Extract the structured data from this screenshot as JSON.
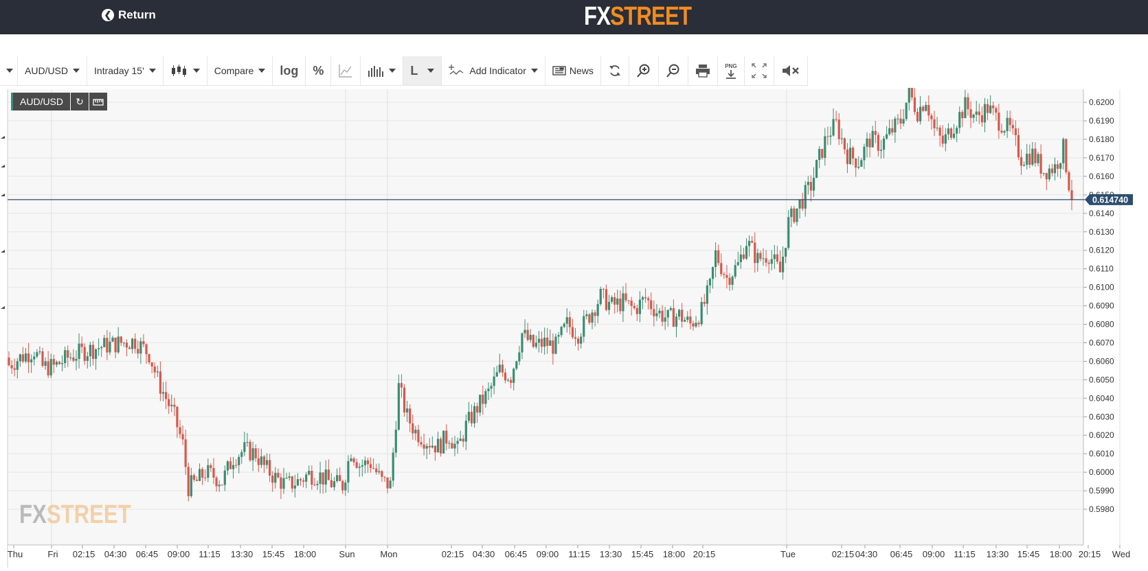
{
  "header": {
    "return_label": "Return",
    "logo_fx": "FX",
    "logo_street": "STREET"
  },
  "toolbar": {
    "symbol": "AUD/USD",
    "interval": "Intraday 15'",
    "compare": "Compare",
    "log": "log",
    "percent": "%",
    "line_label": "L",
    "add_indicator": "Add Indicator",
    "news": "News",
    "png_label": "PNG"
  },
  "badge": {
    "symbol": "AUD/USD"
  },
  "watermark": {
    "fx": "FX",
    "street": "STREET"
  },
  "colors": {
    "up": "#3a8c72",
    "down": "#d9574a",
    "price_line": "#2a4a6a",
    "price_bg": "#2c4e6e"
  },
  "chart_data": {
    "type": "candlestick",
    "symbol": "AUD/USD",
    "interval": "15 min",
    "current_price": "0.614740",
    "ylim": [
      0.598,
      0.6205
    ],
    "y_ticks": [
      "0.6200",
      "0.6190",
      "0.6180",
      "0.6170",
      "0.6160",
      "0.6150",
      "0.6140",
      "0.6130",
      "0.6120",
      "0.6110",
      "0.6100",
      "0.6090",
      "0.6080",
      "0.6070",
      "0.6060",
      "0.6050",
      "0.6040",
      "0.6030",
      "0.6020",
      "0.6010",
      "0.6000",
      "0.5990",
      "0.5980"
    ],
    "x_labels": [
      "Thu",
      "Fri",
      "02:15",
      "04:30",
      "06:45",
      "09:00",
      "11:15",
      "13:30",
      "15:45",
      "18:00",
      "Sun",
      "Mon",
      "02:15",
      "04:30",
      "06:45",
      "09:00",
      "11:15",
      "13:30",
      "15:45",
      "18:00",
      "20:15",
      "Tue",
      "02:15",
      "04:30",
      "06:45",
      "09:00",
      "11:15",
      "13:30",
      "15:45",
      "18:00",
      "20:15",
      "Wed"
    ],
    "close_path": [
      {
        "i": 0,
        "v": 0.6058
      },
      {
        "i": 4,
        "v": 0.6062
      },
      {
        "i": 9,
        "v": 0.6066
      },
      {
        "i": 12,
        "v": 0.6057
      },
      {
        "i": 16,
        "v": 0.6057
      },
      {
        "i": 21,
        "v": 0.6062
      },
      {
        "i": 26,
        "v": 0.6065
      },
      {
        "i": 33,
        "v": 0.6068
      },
      {
        "i": 40,
        "v": 0.607
      },
      {
        "i": 45,
        "v": 0.6071
      },
      {
        "i": 50,
        "v": 0.6064
      },
      {
        "i": 53,
        "v": 0.605
      },
      {
        "i": 56,
        "v": 0.604
      },
      {
        "i": 59,
        "v": 0.603
      },
      {
        "i": 62,
        "v": 0.6015
      },
      {
        "i": 64,
        "v": 0.5992
      },
      {
        "i": 67,
        "v": 0.5995
      },
      {
        "i": 70,
        "v": 0.6
      },
      {
        "i": 73,
        "v": 0.5998
      },
      {
        "i": 76,
        "v": 0.5995
      },
      {
        "i": 80,
        "v": 0.6008
      },
      {
        "i": 84,
        "v": 0.6012
      },
      {
        "i": 88,
        "v": 0.601
      },
      {
        "i": 91,
        "v": 0.6003
      },
      {
        "i": 95,
        "v": 0.5997
      },
      {
        "i": 99,
        "v": 0.5993
      },
      {
        "i": 103,
        "v": 0.5995
      },
      {
        "i": 107,
        "v": 0.5999
      },
      {
        "i": 111,
        "v": 0.5998
      },
      {
        "i": 115,
        "v": 0.5994
      },
      {
        "i": 119,
        "v": 0.5993
      },
      {
        "i": 122,
        "v": 0.6012
      },
      {
        "i": 125,
        "v": 0.6004
      },
      {
        "i": 129,
        "v": 0.6005
      },
      {
        "i": 133,
        "v": 0.5995
      },
      {
        "i": 136,
        "v": 0.5993
      },
      {
        "i": 139,
        "v": 0.6046
      },
      {
        "i": 142,
        "v": 0.603
      },
      {
        "i": 145,
        "v": 0.6022
      },
      {
        "i": 149,
        "v": 0.6017
      },
      {
        "i": 153,
        "v": 0.6014
      },
      {
        "i": 157,
        "v": 0.602
      },
      {
        "i": 160,
        "v": 0.6012
      },
      {
        "i": 163,
        "v": 0.6025
      },
      {
        "i": 167,
        "v": 0.6035
      },
      {
        "i": 171,
        "v": 0.6043
      },
      {
        "i": 175,
        "v": 0.6055
      },
      {
        "i": 179,
        "v": 0.6052
      },
      {
        "i": 183,
        "v": 0.6075
      },
      {
        "i": 187,
        "v": 0.6068
      },
      {
        "i": 191,
        "v": 0.607
      },
      {
        "i": 195,
        "v": 0.6068
      },
      {
        "i": 199,
        "v": 0.608
      },
      {
        "i": 203,
        "v": 0.6075
      },
      {
        "i": 207,
        "v": 0.6085
      },
      {
        "i": 211,
        "v": 0.6095
      },
      {
        "i": 215,
        "v": 0.609
      },
      {
        "i": 219,
        "v": 0.6092
      },
      {
        "i": 223,
        "v": 0.6088
      },
      {
        "i": 227,
        "v": 0.6094
      },
      {
        "i": 231,
        "v": 0.6087
      },
      {
        "i": 235,
        "v": 0.6083
      },
      {
        "i": 239,
        "v": 0.6085
      },
      {
        "i": 243,
        "v": 0.608
      },
      {
        "i": 247,
        "v": 0.6087
      },
      {
        "i": 250,
        "v": 0.61
      },
      {
        "i": 252,
        "v": 0.6118
      },
      {
        "i": 256,
        "v": 0.6105
      },
      {
        "i": 260,
        "v": 0.6112
      },
      {
        "i": 263,
        "v": 0.6125
      },
      {
        "i": 267,
        "v": 0.6115
      },
      {
        "i": 271,
        "v": 0.6118
      },
      {
        "i": 275,
        "v": 0.6108
      },
      {
        "i": 278,
        "v": 0.6135
      },
      {
        "i": 282,
        "v": 0.6145
      },
      {
        "i": 286,
        "v": 0.6155
      },
      {
        "i": 289,
        "v": 0.617
      },
      {
        "i": 292,
        "v": 0.6183
      },
      {
        "i": 295,
        "v": 0.6188
      },
      {
        "i": 299,
        "v": 0.6172
      },
      {
        "i": 303,
        "v": 0.6168
      },
      {
        "i": 307,
        "v": 0.618
      },
      {
        "i": 311,
        "v": 0.6177
      },
      {
        "i": 315,
        "v": 0.6185
      },
      {
        "i": 318,
        "v": 0.619
      },
      {
        "i": 321,
        "v": 0.6205
      },
      {
        "i": 324,
        "v": 0.6195
      },
      {
        "i": 327,
        "v": 0.6202
      },
      {
        "i": 330,
        "v": 0.6185
      },
      {
        "i": 333,
        "v": 0.6178
      },
      {
        "i": 337,
        "v": 0.6188
      },
      {
        "i": 341,
        "v": 0.6198
      },
      {
        "i": 345,
        "v": 0.6192
      },
      {
        "i": 349,
        "v": 0.6197
      },
      {
        "i": 353,
        "v": 0.619
      },
      {
        "i": 357,
        "v": 0.6185
      },
      {
        "i": 361,
        "v": 0.617
      },
      {
        "i": 365,
        "v": 0.6172
      },
      {
        "i": 369,
        "v": 0.6163
      },
      {
        "i": 373,
        "v": 0.6165
      },
      {
        "i": 376,
        "v": 0.6175
      },
      {
        "i": 379,
        "v": 0.6147
      }
    ]
  }
}
